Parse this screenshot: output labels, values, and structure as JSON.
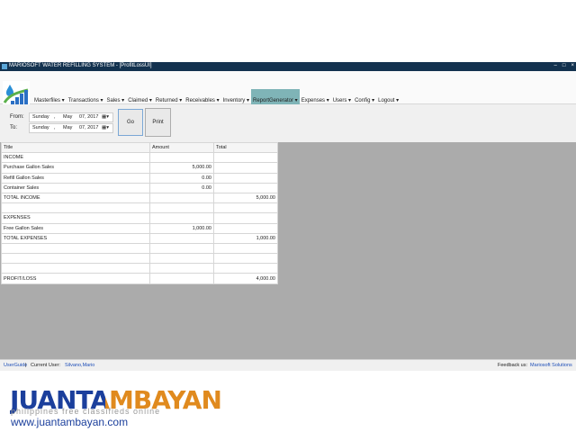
{
  "window": {
    "title": "MARIOSOFT WATER REFILLING SYSTEM - [ProfitLossUI]",
    "min": "–",
    "max": "□",
    "close": "×"
  },
  "menu": [
    {
      "label": "Masterfiles ▾"
    },
    {
      "label": "Transactions ▾"
    },
    {
      "label": "Sales ▾"
    },
    {
      "label": "Claimed ▾"
    },
    {
      "label": "Returned ▾"
    },
    {
      "label": "Receivables ▾"
    },
    {
      "label": "Inventory ▾"
    },
    {
      "label": "ReportGenerator ▾"
    },
    {
      "label": "Expenses ▾"
    },
    {
      "label": "Users ▾"
    },
    {
      "label": "Config ▾"
    },
    {
      "label": "Logout ▾"
    }
  ],
  "filters": {
    "from_label": "From:",
    "to_label": "To:",
    "from": {
      "day": "Sunday",
      "sep": ",",
      "month": "May",
      "date": "07, 2017"
    },
    "to": {
      "day": "Sunday",
      "sep": ",",
      "month": "May",
      "date": "07, 2017"
    },
    "go": "Go",
    "print": "Print"
  },
  "table": {
    "headers": [
      "Title",
      "Amount",
      "Total"
    ],
    "rows": [
      [
        "INCOME",
        "",
        ""
      ],
      [
        "Purchase Gallon Sales",
        "5,000.00",
        ""
      ],
      [
        "Refill Gallon Sales",
        "0.00",
        ""
      ],
      [
        "Container Sales",
        "0.00",
        ""
      ],
      [
        "TOTAL INCOME",
        "",
        "5,000.00"
      ],
      [
        "",
        "",
        ""
      ],
      [
        "EXPENSES",
        "",
        ""
      ],
      [
        "Free Gallon Sales",
        "1,000.00",
        ""
      ],
      [
        "TOTAL EXPENSES",
        "",
        "1,000.00"
      ],
      [
        "",
        "",
        ""
      ],
      [
        "",
        "",
        ""
      ],
      [
        "",
        "",
        ""
      ],
      [
        "PROFIT/LOSS",
        "",
        "4,000.00"
      ]
    ]
  },
  "status": {
    "guide": "UserGuide",
    "divider": "|",
    "current_user_label": "Current User:",
    "current_user": "Silvano,Mario",
    "feedback_label": "Feedback us:",
    "company": "Mariosoft Solutions"
  },
  "watermark": {
    "brand": "JUANTAMBAYAN",
    "tagline": "philippines    free classifieds online",
    "url": "www.juantambayan.com"
  },
  "colors": {
    "titlebar": "#13324f",
    "active_menu": "#7fb4b7",
    "grid_bg": "#ababab"
  }
}
